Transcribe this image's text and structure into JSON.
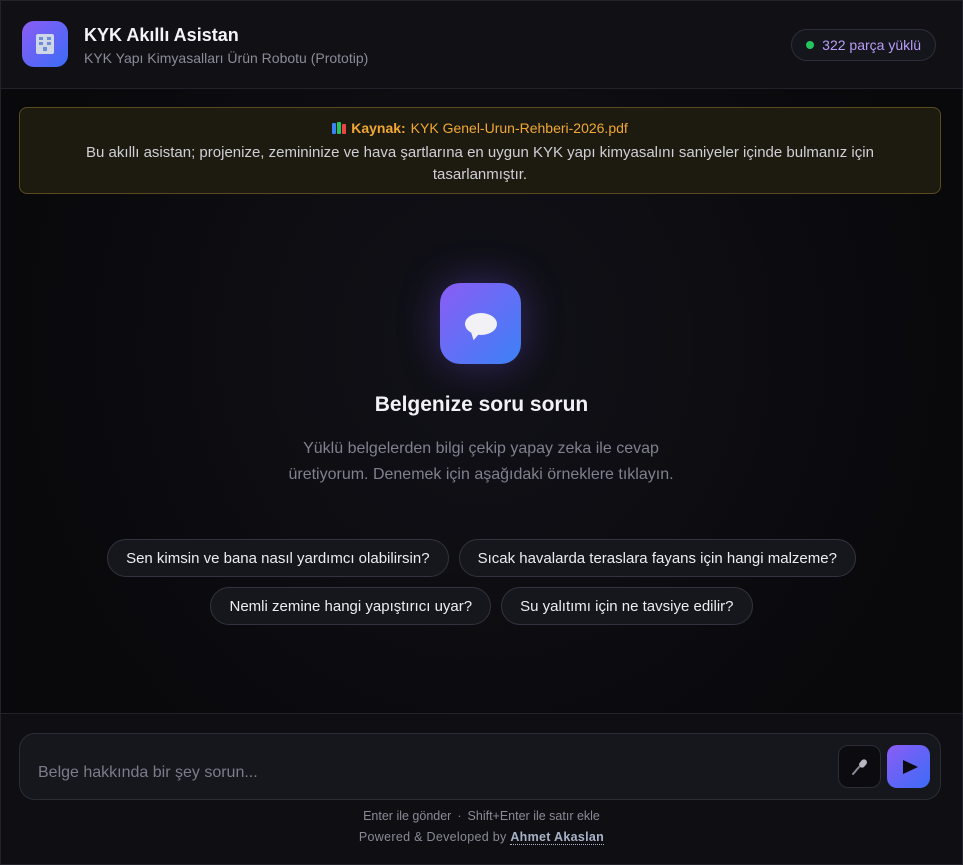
{
  "header": {
    "title": "KYK Akıllı Asistan",
    "subtitle": "KYK Yapı Kimyasalları Ürün Robotu (Prototip)",
    "logo_icon": "building-icon",
    "status": "322 parça yüklü",
    "status_color": "#22c55e"
  },
  "banner": {
    "source_label": "Kaynak:",
    "source_file": "KYK Genel-Urun-Rehberi-2026.pdf",
    "description": "Bu akıllı asistan; projenize, zemininize ve hava şartlarına en uygun KYK yapı kimyasalını saniyeler içinde bulmanız için tasarlanmıştır."
  },
  "empty_state": {
    "icon": "speech-bubble-icon",
    "title": "Belgenize soru sorun",
    "description": "Yüklü belgelerden bilgi çekip yapay zeka ile cevap üretiyorum. Denemek için aşağıdaki örneklere tıklayın."
  },
  "suggestions": [
    "Sen kimsin ve bana nasıl yardımcı olabilirsin?",
    "Sıcak havalarda teraslara fayans için hangi malzeme?",
    "Nemli zemine hangi yapıştırıcı uyar?",
    "Su yalıtımı için ne tavsiye edilir?"
  ],
  "composer": {
    "placeholder": "Belge hakkında bir şey sorun...",
    "value": "",
    "mic_icon": "microphone-icon",
    "send_icon": "send-arrow-icon"
  },
  "footer": {
    "hint_send": "Enter ile gönder",
    "hint_sep": "·",
    "hint_newline": "Shift+Enter ile satır ekle",
    "credit_prefix": "Powered & Developed by",
    "credit_author": "Ahmet Akaslan"
  },
  "colors": {
    "accent_start": "#8b5cf6",
    "accent_end": "#3b6cf6",
    "source_highlight": "#f0a833"
  }
}
